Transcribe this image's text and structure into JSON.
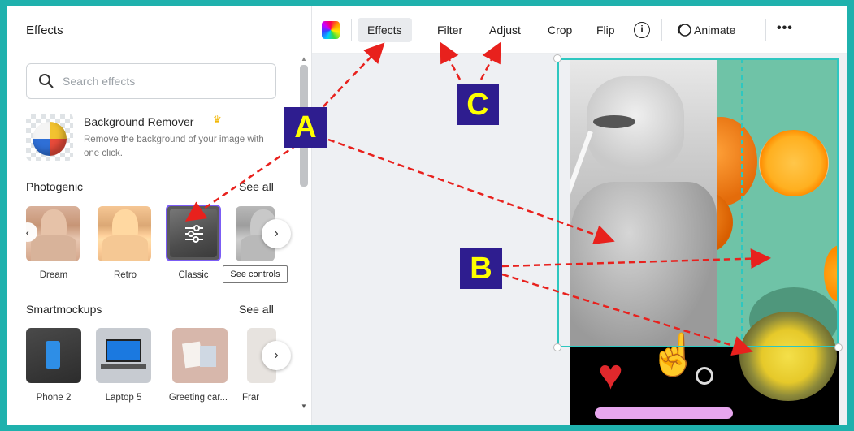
{
  "panel": {
    "title": "Effects",
    "search_placeholder": "Search effects",
    "background_remover": {
      "title": "Background Remover",
      "description": "Remove the background of your image with one click."
    },
    "photogenic": {
      "title": "Photogenic",
      "see_all": "See all",
      "items": [
        {
          "label": "Dream"
        },
        {
          "label": "Retro"
        },
        {
          "label": "Classic"
        }
      ],
      "tooltip": "See controls"
    },
    "smartmockups": {
      "title": "Smartmockups",
      "see_all": "See all",
      "items": [
        {
          "label": "Phone 2"
        },
        {
          "label": "Laptop 5"
        },
        {
          "label": "Greeting car..."
        },
        {
          "label": "Frar"
        }
      ]
    }
  },
  "toolbar": {
    "effects": "Effects",
    "filter": "Filter",
    "adjust": "Adjust",
    "crop": "Crop",
    "flip": "Flip",
    "info": "i",
    "animate": "Animate",
    "more": "•••"
  },
  "annotations": {
    "a": "A",
    "b": "B",
    "c": "C",
    "color": "#e8211d"
  },
  "colors": {
    "frame": "#1fb1ad",
    "label_bg": "#2e1d8f",
    "label_text": "#ffff00",
    "selection": "#2ec7c0",
    "selected_effect": "#7b5cf5"
  }
}
